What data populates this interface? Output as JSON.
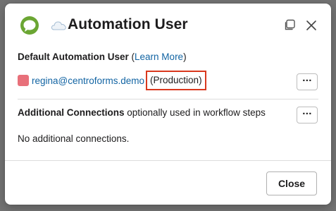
{
  "dialog": {
    "title": "Automation User"
  },
  "default_section": {
    "heading": "Default Automation User",
    "learn_more_prefix": "(",
    "learn_more_label": "Learn More",
    "learn_more_suffix": ")",
    "user_email": "regina@centroforms.demo",
    "environment": "(Production)",
    "more_button": "···"
  },
  "additional_section": {
    "heading_bold": "Additional Connections",
    "heading_rest": " optionally used in workflow steps",
    "more_button": "···",
    "empty_text": "No additional connections."
  },
  "footer": {
    "close_label": "Close"
  },
  "icons": {
    "app_logo": "speech-bubble-logo-icon",
    "cloud": "cloud-icon",
    "popout": "popout-window-icon",
    "close": "close-icon",
    "avatar": "user-avatar-icon"
  },
  "colors": {
    "link": "#1264a3",
    "highlight_box": "#d9381e",
    "logo_green": "#6ba633",
    "avatar": "#e8707a"
  }
}
